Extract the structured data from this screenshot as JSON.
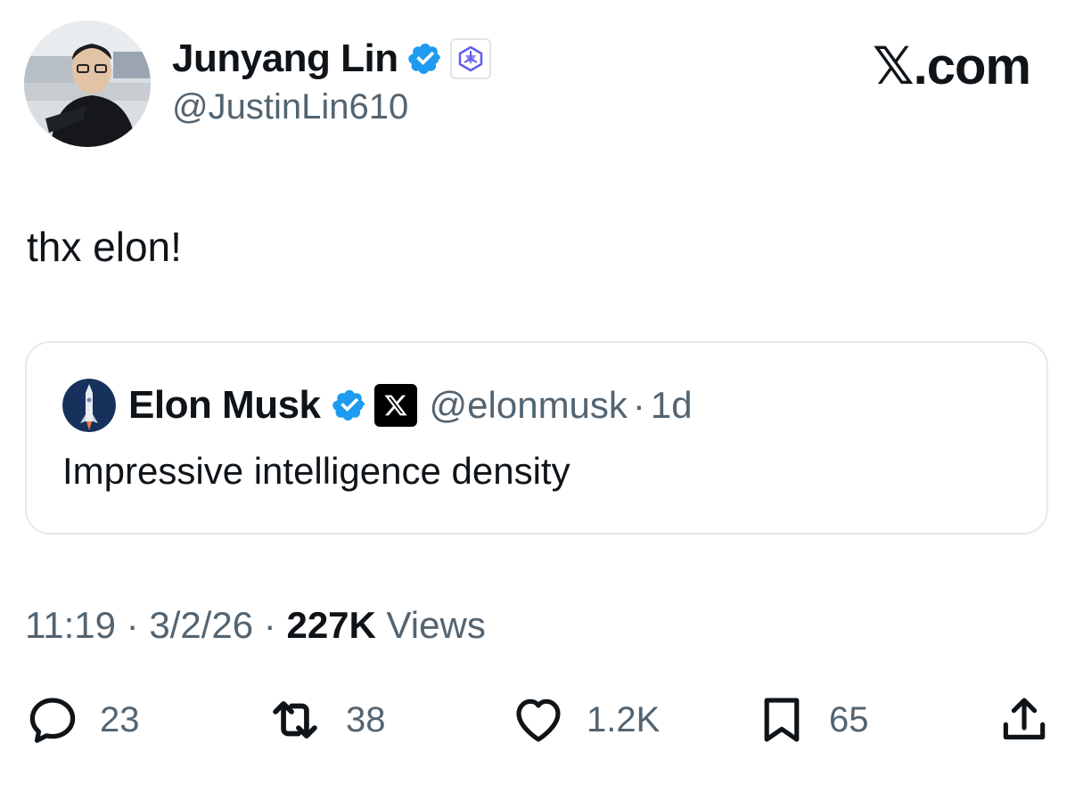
{
  "tweet": {
    "author_name": "Junyang Lin",
    "author_handle": "@JustinLin610",
    "text": "thx elon!",
    "time": "11:19",
    "date": "3/2/26",
    "separator": "·",
    "views_count": "227K",
    "views_label": "Views"
  },
  "brand": "𝕏.com",
  "quote": {
    "author_name": "Elon Musk",
    "author_handle": "@elonmusk",
    "separator": "·",
    "age": "1d",
    "text": "Impressive intelligence density"
  },
  "actions": {
    "replies": "23",
    "reposts": "38",
    "likes": "1.2K",
    "bookmarks": "65"
  },
  "colors": {
    "verified_blue": "#1d9bf0",
    "text_primary": "#0f1419",
    "text_secondary": "#536471",
    "affiliate_badge_purple": "#615ced"
  },
  "icons": {
    "verified": "verified-check-icon",
    "affiliate": "qwen-logo-icon",
    "x_badge": "x-logo-icon",
    "reply": "reply-icon",
    "repost": "repost-icon",
    "like": "heart-icon",
    "bookmark": "bookmark-icon",
    "share": "share-icon"
  }
}
